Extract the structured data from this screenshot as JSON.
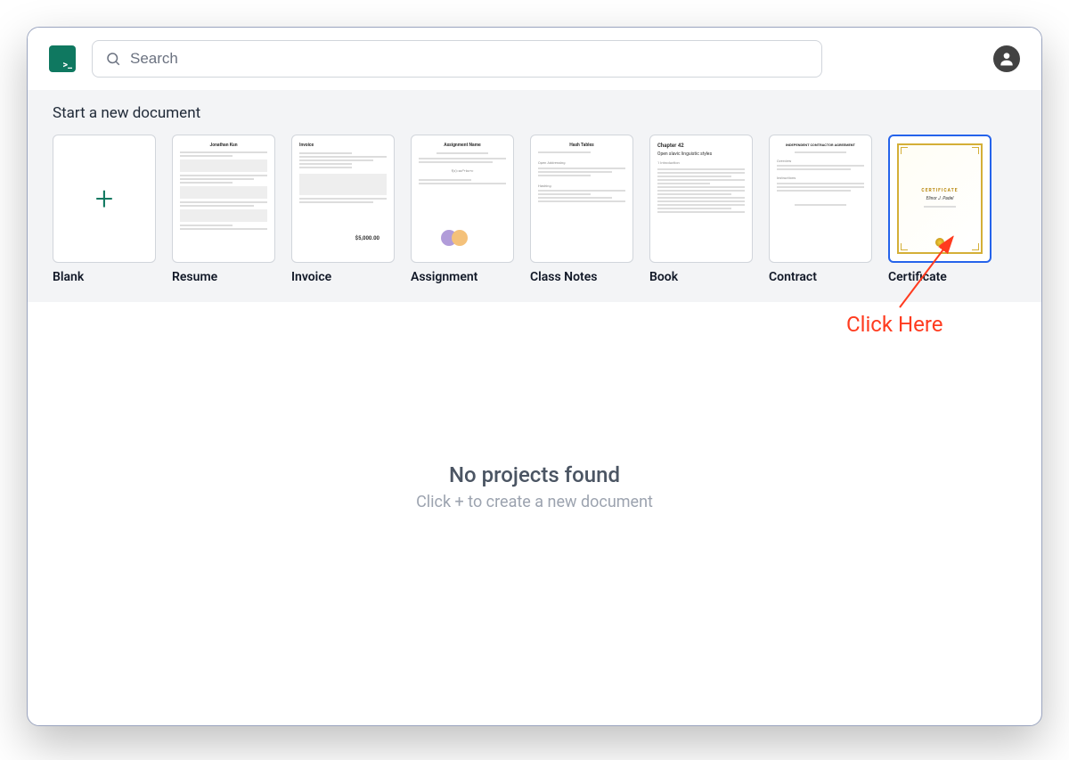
{
  "header": {
    "search_placeholder": "Search"
  },
  "templates": {
    "section_title": "Start a new document",
    "items": [
      {
        "label": "Blank",
        "type": "blank"
      },
      {
        "label": "Resume",
        "type": "resume",
        "preview_title": "Jonathan Kun"
      },
      {
        "label": "Invoice",
        "type": "invoice",
        "preview_title": "Invoice",
        "preview_total": "$5,000.00"
      },
      {
        "label": "Assignment",
        "type": "assignment",
        "preview_title": "Assignment Name"
      },
      {
        "label": "Class Notes",
        "type": "classnotes",
        "preview_title": "Hash Tables"
      },
      {
        "label": "Book",
        "type": "book",
        "preview_chapter": "Chapter 42",
        "preview_subtitle": "Open slavic linguistic styles"
      },
      {
        "label": "Contract",
        "type": "contract",
        "preview_title": "INDEPENDENT CONTRACTOR AGREEMENT"
      },
      {
        "label": "Certificate",
        "type": "certificate",
        "selected": true,
        "preview_heading": "CERTIFICATE"
      }
    ]
  },
  "empty_state": {
    "title": "No projects found",
    "subtitle": "Click + to create a new document"
  },
  "annotation": {
    "text": "Click Here"
  }
}
